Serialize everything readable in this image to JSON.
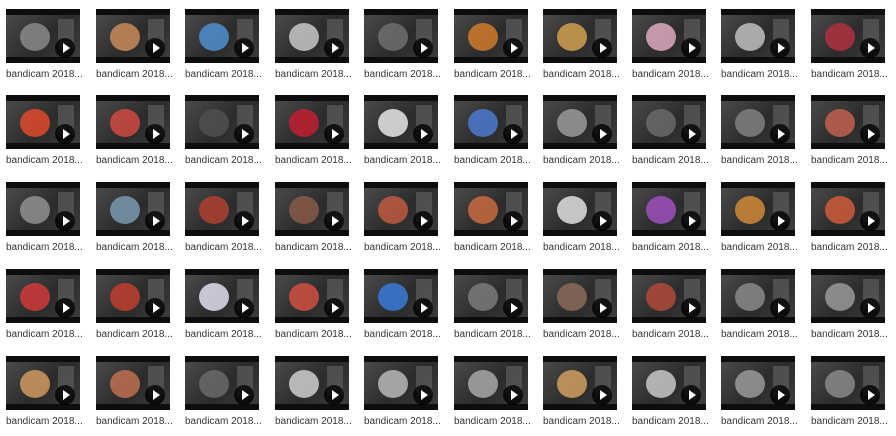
{
  "files": [
    {
      "label": "bandicam 2018...",
      "tint": "#8a8a8a"
    },
    {
      "label": "bandicam 2018...",
      "tint": "#c98a5a"
    },
    {
      "label": "bandicam 2018...",
      "tint": "#4f8fd0"
    },
    {
      "label": "bandicam 2018...",
      "tint": "#c8c8c8"
    },
    {
      "label": "bandicam 2018...",
      "tint": "#6e6e6e"
    },
    {
      "label": "bandicam 2018...",
      "tint": "#d07a2a"
    },
    {
      "label": "bandicam 2018...",
      "tint": "#d0a050"
    },
    {
      "label": "bandicam 2018...",
      "tint": "#e0a8c0"
    },
    {
      "label": "bandicam 2018...",
      "tint": "#bfbfbf"
    },
    {
      "label": "bandicam 2018...",
      "tint": "#b03040"
    },
    {
      "label": "bandicam 2018...",
      "tint": "#e04a2a"
    },
    {
      "label": "bandicam 2018...",
      "tint": "#d04a40"
    },
    {
      "label": "bandicam 2018...",
      "tint": "#505050"
    },
    {
      "label": "bandicam 2018...",
      "tint": "#c02030"
    },
    {
      "label": "bandicam 2018...",
      "tint": "#e8e8e8"
    },
    {
      "label": "bandicam 2018...",
      "tint": "#4a7ad0"
    },
    {
      "label": "bandicam 2018...",
      "tint": "#9a9a9a"
    },
    {
      "label": "bandicam 2018...",
      "tint": "#6a6a6a"
    },
    {
      "label": "bandicam 2018...",
      "tint": "#808080"
    },
    {
      "label": "bandicam 2018...",
      "tint": "#c06050"
    },
    {
      "label": "bandicam 2018...",
      "tint": "#909090"
    },
    {
      "label": "bandicam 2018...",
      "tint": "#7a9ab0"
    },
    {
      "label": "bandicam 2018...",
      "tint": "#b04030"
    },
    {
      "label": "bandicam 2018...",
      "tint": "#8a5a4a"
    },
    {
      "label": "bandicam 2018...",
      "tint": "#c05a40"
    },
    {
      "label": "bandicam 2018...",
      "tint": "#c86a40"
    },
    {
      "label": "bandicam 2018...",
      "tint": "#e0e0e0"
    },
    {
      "label": "bandicam 2018...",
      "tint": "#a050c0"
    },
    {
      "label": "bandicam 2018...",
      "tint": "#d08a3a"
    },
    {
      "label": "bandicam 2018...",
      "tint": "#d05a3a"
    },
    {
      "label": "bandicam 2018...",
      "tint": "#d03a3a"
    },
    {
      "label": "bandicam 2018...",
      "tint": "#c04030"
    },
    {
      "label": "bandicam 2018...",
      "tint": "#e0e0f0"
    },
    {
      "label": "bandicam 2018...",
      "tint": "#d05040"
    },
    {
      "label": "bandicam 2018...",
      "tint": "#3a7ad8"
    },
    {
      "label": "bandicam 2018...",
      "tint": "#7a7a7a"
    },
    {
      "label": "bandicam 2018...",
      "tint": "#8a6a5a"
    },
    {
      "label": "bandicam 2018...",
      "tint": "#b04a3a"
    },
    {
      "label": "bandicam 2018...",
      "tint": "#8a8a8a"
    },
    {
      "label": "bandicam 2018...",
      "tint": "#9a9a9a"
    },
    {
      "label": "bandicam 2018...",
      "tint": "#d09a60"
    },
    {
      "label": "bandicam 2018...",
      "tint": "#c07050"
    },
    {
      "label": "bandicam 2018...",
      "tint": "#6a6a6a"
    },
    {
      "label": "bandicam 2018...",
      "tint": "#cfcfcf"
    },
    {
      "label": "bandicam 2018...",
      "tint": "#b8b8b8"
    },
    {
      "label": "bandicam 2018...",
      "tint": "#a8a8a8"
    },
    {
      "label": "bandicam 2018...",
      "tint": "#d0a060"
    },
    {
      "label": "bandicam 2018...",
      "tint": "#c8c8c8"
    },
    {
      "label": "bandicam 2018...",
      "tint": "#9a9a9a"
    },
    {
      "label": "bandicam 2018...",
      "tint": "#8a8a8a"
    }
  ]
}
